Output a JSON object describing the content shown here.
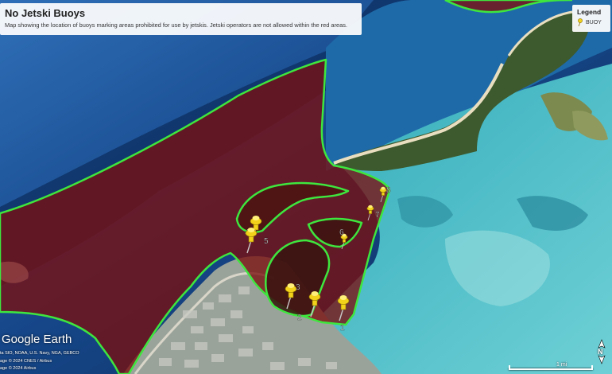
{
  "header": {
    "title": "No Jetski Buoys",
    "description": "Map showing the location of buoys marking areas prohibited for use by jetskis. Jetski operators are not allowed within the red areas."
  },
  "legend": {
    "title": "Legend",
    "items": [
      {
        "label": "BUOY",
        "icon": "yellow-pushpin-icon"
      }
    ]
  },
  "map": {
    "buoys": [
      {
        "label": "1"
      },
      {
        "label": "2"
      },
      {
        "label": "3"
      },
      {
        "label": "4"
      },
      {
        "label": "5"
      },
      {
        "label": "6"
      },
      {
        "label": "7"
      },
      {
        "label": "8"
      }
    ],
    "colors": {
      "restricted_fill": "#7a1010",
      "restricted_border": "#3ee63e",
      "buoy": "#f2d21b",
      "deep_water": "#0b2a55",
      "shallow_water": "#4fc0c9"
    }
  },
  "branding": {
    "logo": "Google Earth"
  },
  "credits": [
    "ta SIO, NOAA, U.S. Navy, NGA, GEBCO",
    "age © 2024 CNES / Airbus",
    "age © 2024 Airbus"
  ],
  "scale": {
    "label": "1 mi"
  },
  "north": {
    "label": "N",
    "icon": "north-arrow-icon"
  }
}
